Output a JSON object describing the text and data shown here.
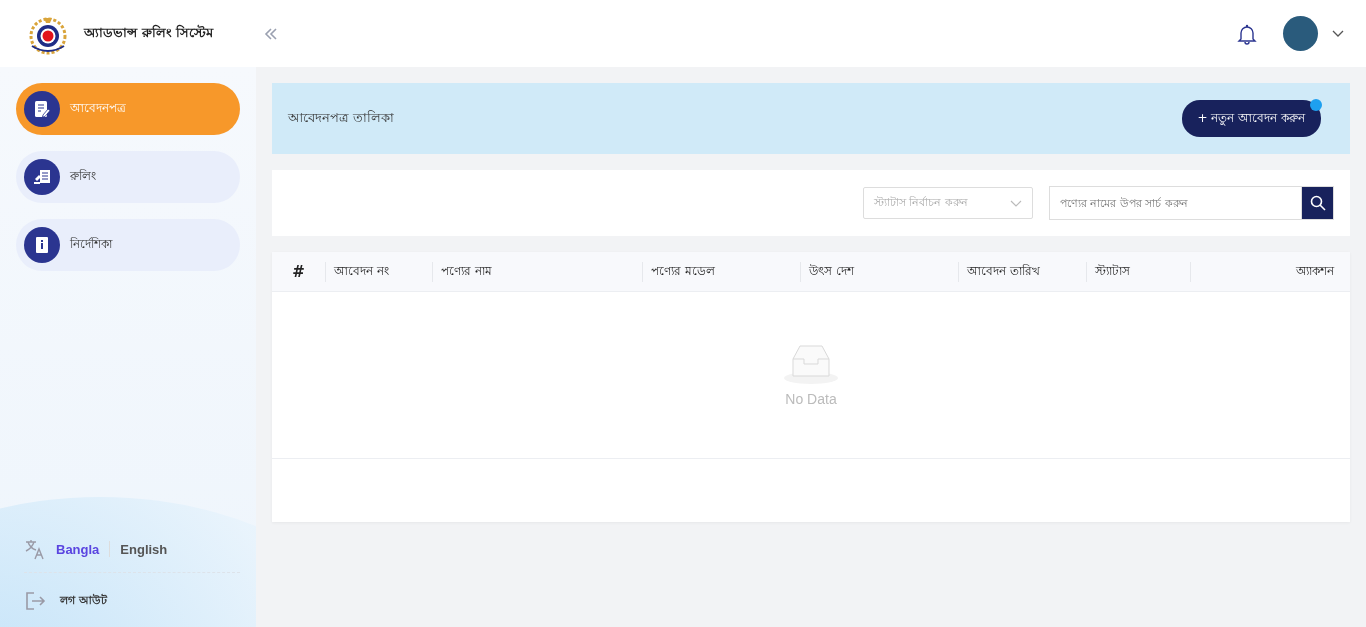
{
  "header": {
    "app_title": "অ্যাডভান্স রুলিং সিস্টেম"
  },
  "sidebar": {
    "items": [
      {
        "label": "আবেদনপত্র",
        "selected": true
      },
      {
        "label": "রুলিং",
        "selected": false
      },
      {
        "label": "নির্দেশিকা",
        "selected": false
      }
    ],
    "languages": [
      {
        "label": "Bangla",
        "selected": true
      },
      {
        "label": "English",
        "selected": false
      }
    ],
    "logout": "লগ আউট"
  },
  "page_header": {
    "title": "আবেদনপত্র তালিকা",
    "new_button": "+ নতুন আবেদন করুন",
    "notification_dot": true
  },
  "filters": {
    "status_select": {
      "placeholder": "স্ট্যাটাস নির্বাচন করুন"
    },
    "search": {
      "placeholder": "পণ্যের নামের উপর সার্চ করুন"
    }
  },
  "table": {
    "columns": [
      "#",
      "আবেদন নং",
      "পণ্যের নাম",
      "পণ্যের মডেল",
      "উৎস দেশ",
      "আবেদন তারিখ",
      "স্ট্যাটাস",
      "অ্যাকশন"
    ],
    "empty_text": "No Data"
  }
}
